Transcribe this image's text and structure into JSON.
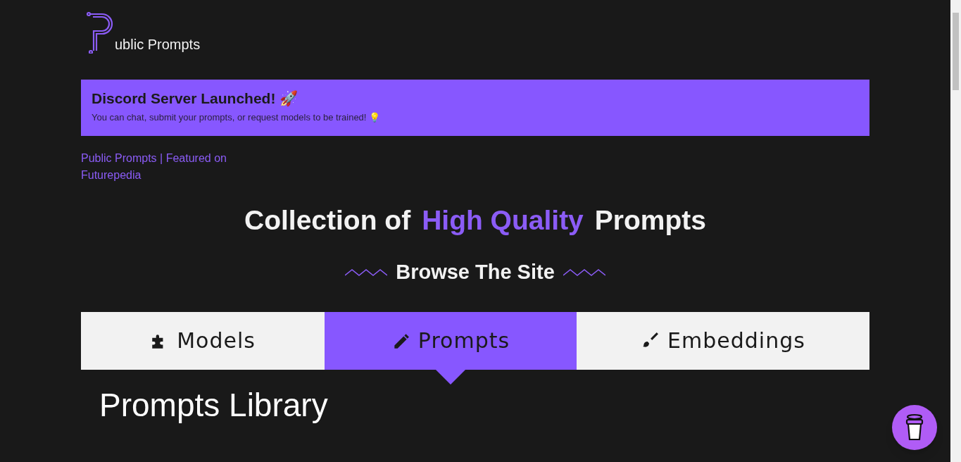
{
  "logo": {
    "text": "ublic Prompts"
  },
  "banner": {
    "title": "Discord Server Launched! 🚀",
    "text": "You can chat, submit your prompts, or request models to be trained! 💡"
  },
  "featured_image": {
    "alt": "Public Prompts | Featured on Futurepedia"
  },
  "headline": {
    "parts": [
      {
        "text": "Collection of",
        "highlight": false
      },
      {
        "text": "High Quality",
        "highlight": true
      },
      {
        "text": "Prompts",
        "highlight": false
      }
    ]
  },
  "section_title": "Browse The Site",
  "tabs": [
    {
      "label": "Models",
      "kind": "puzzle",
      "selected": false
    },
    {
      "label": "Prompts",
      "kind": "pencil",
      "selected": true
    },
    {
      "label": "Embeddings",
      "kind": "brush",
      "selected": false
    }
  ],
  "library_title": "Prompts Library"
}
